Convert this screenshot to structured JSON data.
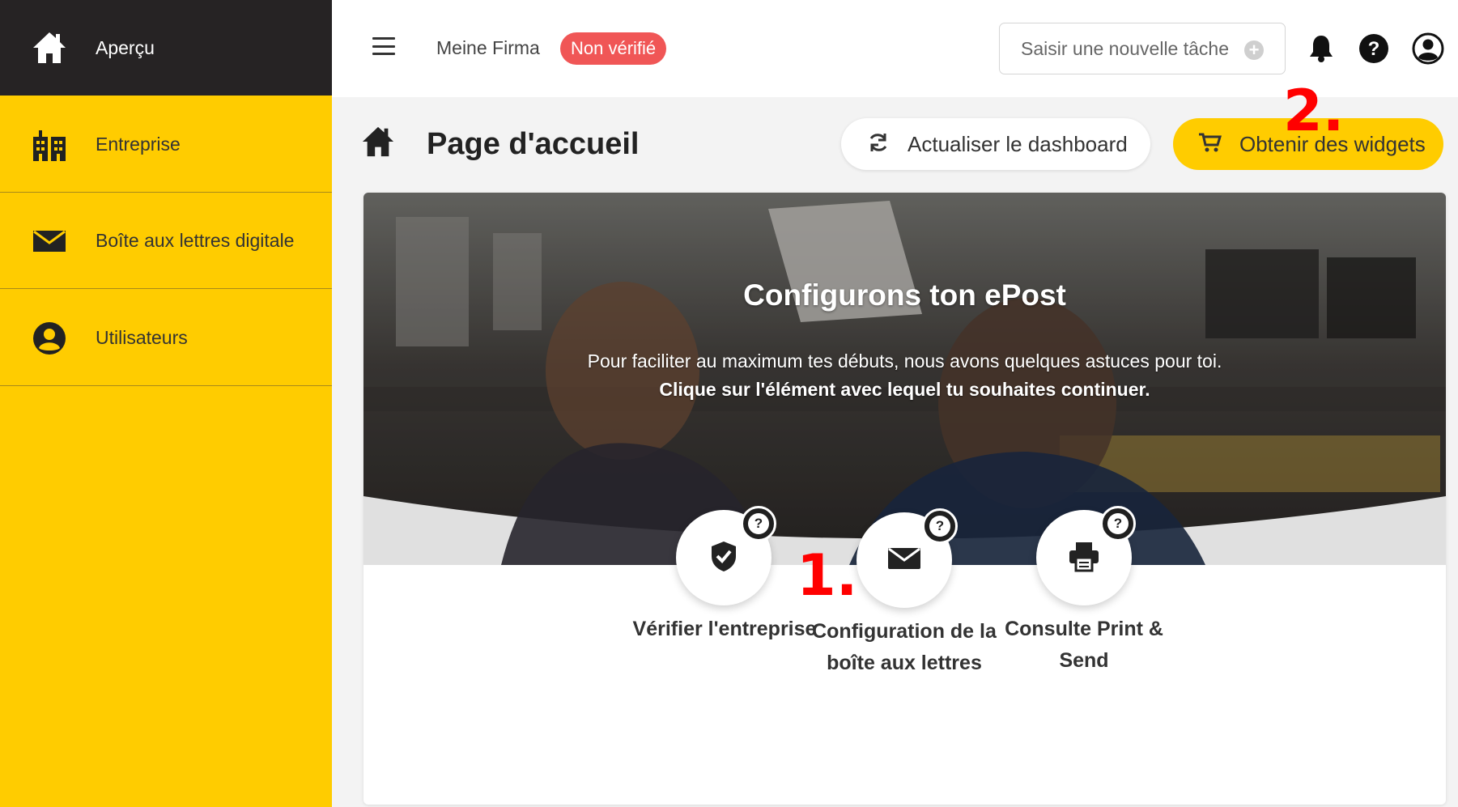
{
  "sidebar": {
    "items": [
      {
        "label": "Aperçu",
        "icon": "home-icon"
      },
      {
        "label": "Entreprise",
        "icon": "building-icon"
      },
      {
        "label": "Boîte aux lettres digitale",
        "icon": "envelope-icon"
      },
      {
        "label": "Utilisateurs",
        "icon": "user-icon"
      }
    ]
  },
  "topbar": {
    "company": "Meine Firma",
    "status_badge": "Non vérifié",
    "task_placeholder": "Saisir une nouvelle tâche"
  },
  "page": {
    "title": "Page d'accueil",
    "refresh_button": "Actualiser le dashboard",
    "widgets_button": "Obtenir des widgets"
  },
  "hero": {
    "title": "Configurons ton ePost",
    "subtitle": "Pour faciliter au maximum tes débuts, nous avons quelques astuces pour toi.",
    "instruction": "Clique sur l'élément avec lequel tu souhaites continuer."
  },
  "steps": [
    {
      "label": "Vérifier l'entreprise",
      "icon": "shield-check-icon"
    },
    {
      "label": "Configuration de la boîte aux lettres",
      "icon": "envelope-icon"
    },
    {
      "label": "Consulte Print & Send",
      "icon": "printer-icon"
    }
  ],
  "annotations": {
    "one": "1.",
    "two": "2."
  },
  "colors": {
    "accent": "#ffcc00",
    "sidebar_active": "#262324",
    "badge": "#f05656",
    "annotation": "#ff0000"
  }
}
